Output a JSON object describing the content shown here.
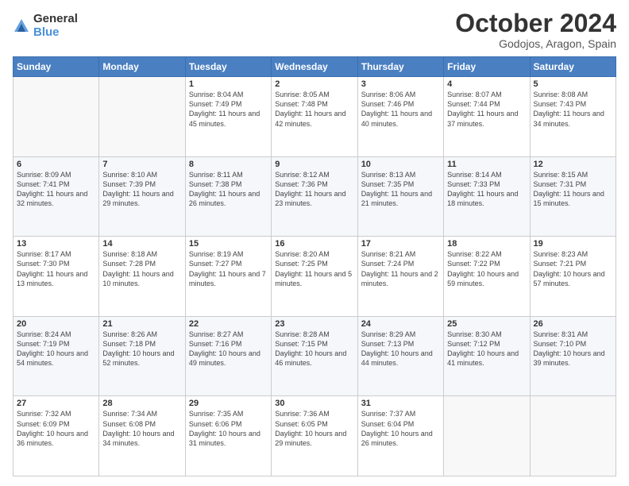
{
  "header": {
    "logo": {
      "general": "General",
      "blue": "Blue"
    },
    "title": "October 2024",
    "location": "Godojos, Aragon, Spain"
  },
  "weekdays": [
    "Sunday",
    "Monday",
    "Tuesday",
    "Wednesday",
    "Thursday",
    "Friday",
    "Saturday"
  ],
  "weeks": [
    [
      {
        "day": "",
        "detail": ""
      },
      {
        "day": "",
        "detail": ""
      },
      {
        "day": "1",
        "detail": "Sunrise: 8:04 AM\nSunset: 7:49 PM\nDaylight: 11 hours and 45 minutes."
      },
      {
        "day": "2",
        "detail": "Sunrise: 8:05 AM\nSunset: 7:48 PM\nDaylight: 11 hours and 42 minutes."
      },
      {
        "day": "3",
        "detail": "Sunrise: 8:06 AM\nSunset: 7:46 PM\nDaylight: 11 hours and 40 minutes."
      },
      {
        "day": "4",
        "detail": "Sunrise: 8:07 AM\nSunset: 7:44 PM\nDaylight: 11 hours and 37 minutes."
      },
      {
        "day": "5",
        "detail": "Sunrise: 8:08 AM\nSunset: 7:43 PM\nDaylight: 11 hours and 34 minutes."
      }
    ],
    [
      {
        "day": "6",
        "detail": "Sunrise: 8:09 AM\nSunset: 7:41 PM\nDaylight: 11 hours and 32 minutes."
      },
      {
        "day": "7",
        "detail": "Sunrise: 8:10 AM\nSunset: 7:39 PM\nDaylight: 11 hours and 29 minutes."
      },
      {
        "day": "8",
        "detail": "Sunrise: 8:11 AM\nSunset: 7:38 PM\nDaylight: 11 hours and 26 minutes."
      },
      {
        "day": "9",
        "detail": "Sunrise: 8:12 AM\nSunset: 7:36 PM\nDaylight: 11 hours and 23 minutes."
      },
      {
        "day": "10",
        "detail": "Sunrise: 8:13 AM\nSunset: 7:35 PM\nDaylight: 11 hours and 21 minutes."
      },
      {
        "day": "11",
        "detail": "Sunrise: 8:14 AM\nSunset: 7:33 PM\nDaylight: 11 hours and 18 minutes."
      },
      {
        "day": "12",
        "detail": "Sunrise: 8:15 AM\nSunset: 7:31 PM\nDaylight: 11 hours and 15 minutes."
      }
    ],
    [
      {
        "day": "13",
        "detail": "Sunrise: 8:17 AM\nSunset: 7:30 PM\nDaylight: 11 hours and 13 minutes."
      },
      {
        "day": "14",
        "detail": "Sunrise: 8:18 AM\nSunset: 7:28 PM\nDaylight: 11 hours and 10 minutes."
      },
      {
        "day": "15",
        "detail": "Sunrise: 8:19 AM\nSunset: 7:27 PM\nDaylight: 11 hours and 7 minutes."
      },
      {
        "day": "16",
        "detail": "Sunrise: 8:20 AM\nSunset: 7:25 PM\nDaylight: 11 hours and 5 minutes."
      },
      {
        "day": "17",
        "detail": "Sunrise: 8:21 AM\nSunset: 7:24 PM\nDaylight: 11 hours and 2 minutes."
      },
      {
        "day": "18",
        "detail": "Sunrise: 8:22 AM\nSunset: 7:22 PM\nDaylight: 10 hours and 59 minutes."
      },
      {
        "day": "19",
        "detail": "Sunrise: 8:23 AM\nSunset: 7:21 PM\nDaylight: 10 hours and 57 minutes."
      }
    ],
    [
      {
        "day": "20",
        "detail": "Sunrise: 8:24 AM\nSunset: 7:19 PM\nDaylight: 10 hours and 54 minutes."
      },
      {
        "day": "21",
        "detail": "Sunrise: 8:26 AM\nSunset: 7:18 PM\nDaylight: 10 hours and 52 minutes."
      },
      {
        "day": "22",
        "detail": "Sunrise: 8:27 AM\nSunset: 7:16 PM\nDaylight: 10 hours and 49 minutes."
      },
      {
        "day": "23",
        "detail": "Sunrise: 8:28 AM\nSunset: 7:15 PM\nDaylight: 10 hours and 46 minutes."
      },
      {
        "day": "24",
        "detail": "Sunrise: 8:29 AM\nSunset: 7:13 PM\nDaylight: 10 hours and 44 minutes."
      },
      {
        "day": "25",
        "detail": "Sunrise: 8:30 AM\nSunset: 7:12 PM\nDaylight: 10 hours and 41 minutes."
      },
      {
        "day": "26",
        "detail": "Sunrise: 8:31 AM\nSunset: 7:10 PM\nDaylight: 10 hours and 39 minutes."
      }
    ],
    [
      {
        "day": "27",
        "detail": "Sunrise: 7:32 AM\nSunset: 6:09 PM\nDaylight: 10 hours and 36 minutes."
      },
      {
        "day": "28",
        "detail": "Sunrise: 7:34 AM\nSunset: 6:08 PM\nDaylight: 10 hours and 34 minutes."
      },
      {
        "day": "29",
        "detail": "Sunrise: 7:35 AM\nSunset: 6:06 PM\nDaylight: 10 hours and 31 minutes."
      },
      {
        "day": "30",
        "detail": "Sunrise: 7:36 AM\nSunset: 6:05 PM\nDaylight: 10 hours and 29 minutes."
      },
      {
        "day": "31",
        "detail": "Sunrise: 7:37 AM\nSunset: 6:04 PM\nDaylight: 10 hours and 26 minutes."
      },
      {
        "day": "",
        "detail": ""
      },
      {
        "day": "",
        "detail": ""
      }
    ]
  ]
}
